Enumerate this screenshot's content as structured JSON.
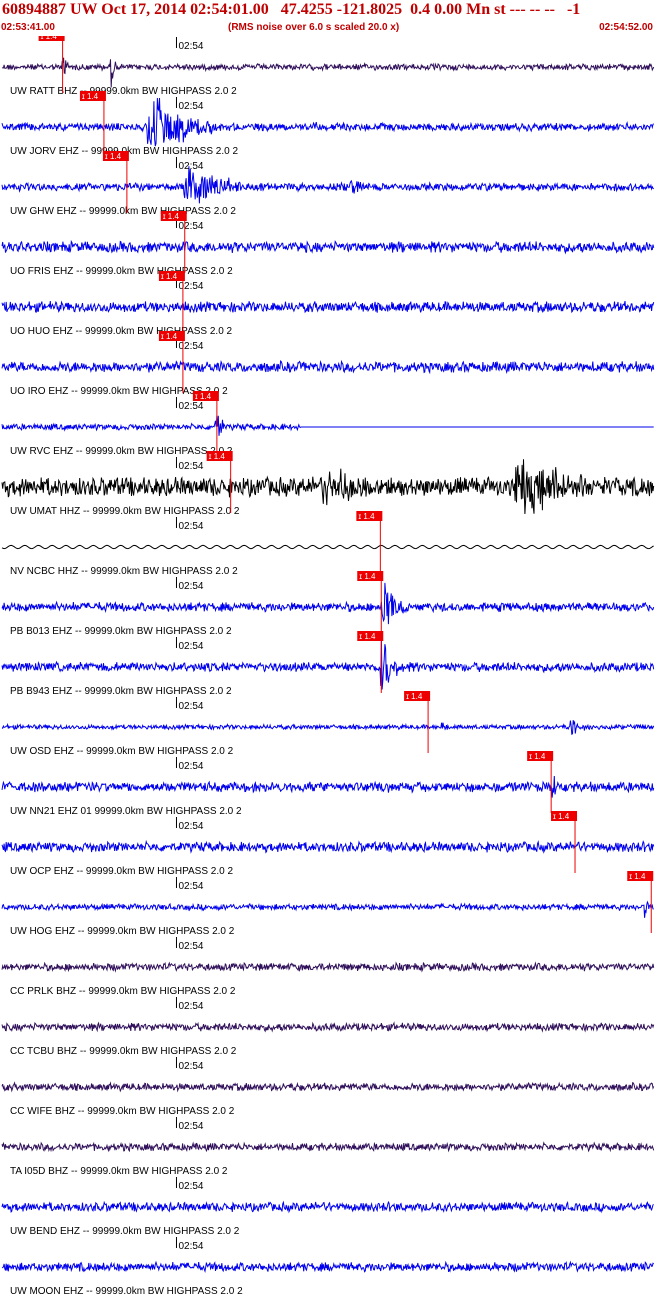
{
  "header": {
    "title": "60894887 UW Oct 17, 2014 02:54:01.00   47.4255 -121.8025  0.4 0.00 Mn st --- -- --   -1",
    "start_time": "02:53:41.00",
    "note": "(RMS noise over 6.0 s scaled 20.0 x)",
    "end_time": "02:54:52.00"
  },
  "colors": {
    "header_text": "#c00000",
    "blue_trace": "#0000ee",
    "black_trace": "#000000",
    "purple_trace": "#30105a",
    "pick_marker": "#ee0000",
    "tick_label": "#000000"
  },
  "chart_data": {
    "type": "line",
    "x_range_seconds": [
      0,
      71
    ],
    "minute_tick_seconds": 19,
    "minute_tick_label": "02:54",
    "pick_label": "ɪ 1.4",
    "traces": [
      {
        "label": "UW RATT BHZ -- 99999.0km BW  HIGHPASS  2.0  2",
        "color": "purple",
        "amplitude": 0.08,
        "pick_seconds": 6.6,
        "bursts": [
          {
            "t": 6.8,
            "amp": 0.9,
            "w": 0.4
          },
          {
            "t": 12.0,
            "amp": 0.85,
            "w": 0.4
          }
        ]
      },
      {
        "label": "UW JORV EHZ -- 99999.0km BW  HIGHPASS  2.0  2",
        "color": "blue",
        "amplitude": 0.1,
        "pick_seconds": 11.1,
        "bursts": [
          {
            "t": 16.0,
            "amp": 1.1,
            "w": 7.0
          },
          {
            "t": 34.0,
            "amp": 0.25,
            "w": 1.2
          }
        ]
      },
      {
        "label": "UW GHW EHZ -- 99999.0km BW  HIGHPASS  2.0  2",
        "color": "blue",
        "amplitude": 0.1,
        "pick_seconds": 13.6,
        "bursts": [
          {
            "t": 20.0,
            "amp": 0.9,
            "w": 6.0
          },
          {
            "t": 38.0,
            "amp": 0.35,
            "w": 3.0
          }
        ]
      },
      {
        "label": "UO FRIS EHZ -- 99999.0km BW  HIGHPASS  2.0  2",
        "color": "blue",
        "amplitude": 0.14,
        "pick_seconds": 19.9,
        "bursts": []
      },
      {
        "label": "UO HUO EHZ -- 99999.0km BW  HIGHPASS  2.0  2",
        "color": "blue",
        "amplitude": 0.14,
        "pick_seconds": 19.7,
        "bursts": []
      },
      {
        "label": "UO IRO EHZ -- 99999.0km BW  HIGHPASS  2.0  2",
        "color": "blue",
        "amplitude": 0.14,
        "pick_seconds": 19.7,
        "bursts": []
      },
      {
        "label": "UW RVC EHZ -- 99999.0km BW  HIGHPASS  2.0  2",
        "color": "blue",
        "amplitude": 0.08,
        "pick_seconds": 23.4,
        "end_seconds": 32.5,
        "bursts": [
          {
            "t": 23.3,
            "amp": 0.8,
            "w": 0.9
          }
        ]
      },
      {
        "label": "UW UMAT HHZ -- 99999.0km BW  HIGHPASS  2.0  2",
        "color": "black",
        "amplitude": 0.25,
        "pick_seconds": 24.9,
        "bursts": [
          {
            "t": 35.0,
            "amp": 0.7,
            "w": 9.0
          },
          {
            "t": 56.0,
            "amp": 1.0,
            "w": 12.0
          }
        ]
      },
      {
        "label": "NV NCBC HHZ -- 99999.0km BW  HIGHPASS  2.0  2",
        "color": "black",
        "amplitude": 0.06,
        "pick_seconds": 41.2,
        "smooth": true,
        "bursts": []
      },
      {
        "label": "PB B013 EHZ -- 99999.0km BW  HIGHPASS  2.0  2",
        "color": "blue",
        "amplitude": 0.12,
        "pick_seconds": 41.3,
        "bursts": [
          {
            "t": 41.5,
            "amp": 0.95,
            "w": 2.5
          }
        ]
      },
      {
        "label": "PB B943 EHZ -- 99999.0km BW  HIGHPASS  2.0  2",
        "color": "blue",
        "amplitude": 0.12,
        "pick_seconds": 41.3,
        "bursts": [
          {
            "t": 41.3,
            "amp": 1.0,
            "w": 2.5
          }
        ]
      },
      {
        "label": "UW OSD EHZ -- 99999.0km BW  HIGHPASS  2.0  2",
        "color": "blue",
        "amplitude": 0.06,
        "pick_seconds": 46.4,
        "bursts": [
          {
            "t": 48.0,
            "amp": 0.2,
            "w": 1.2
          },
          {
            "t": 62.0,
            "amp": 0.3,
            "w": 3.0
          }
        ]
      },
      {
        "label": "UW NN21 EHZ 01 99999.0km BW  HIGHPASS  2.0  2",
        "color": "blue",
        "amplitude": 0.13,
        "pick_seconds": 59.8,
        "bursts": [
          {
            "t": 60.0,
            "amp": 0.45,
            "w": 1.0
          }
        ]
      },
      {
        "label": "UW OCP EHZ -- 99999.0km BW  HIGHPASS  2.0  2",
        "color": "blue",
        "amplitude": 0.13,
        "pick_seconds": 62.4,
        "bursts": []
      },
      {
        "label": "UW HOG EHZ -- 99999.0km BW  HIGHPASS  2.0  2",
        "color": "blue",
        "amplitude": 0.08,
        "pick_seconds": 70.7,
        "bursts": [
          {
            "t": 70.0,
            "amp": 0.4,
            "w": 0.8
          }
        ]
      },
      {
        "label": "CC PRLK BHZ -- 99999.0km BW  HIGHPASS  2.0  2",
        "color": "purple",
        "amplitude": 0.1,
        "bursts": []
      },
      {
        "label": "CC TCBU BHZ -- 99999.0km BW  HIGHPASS  2.0  2",
        "color": "purple",
        "amplitude": 0.1,
        "bursts": []
      },
      {
        "label": "CC WIFE BHZ -- 99999.0km BW  HIGHPASS  2.0  2",
        "color": "purple",
        "amplitude": 0.1,
        "bursts": []
      },
      {
        "label": "TA I05D BHZ -- 99999.0km BW  HIGHPASS  2.0  2",
        "color": "purple",
        "amplitude": 0.1,
        "bursts": []
      },
      {
        "label": "UW BEND EHZ -- 99999.0km BW  HIGHPASS  2.0  2",
        "color": "blue",
        "amplitude": 0.12,
        "bursts": []
      },
      {
        "label": "UW MOON EHZ -- 99999.0km BW  HIGHPASS  2.0  2",
        "color": "blue",
        "amplitude": 0.12,
        "bursts": []
      }
    ]
  }
}
